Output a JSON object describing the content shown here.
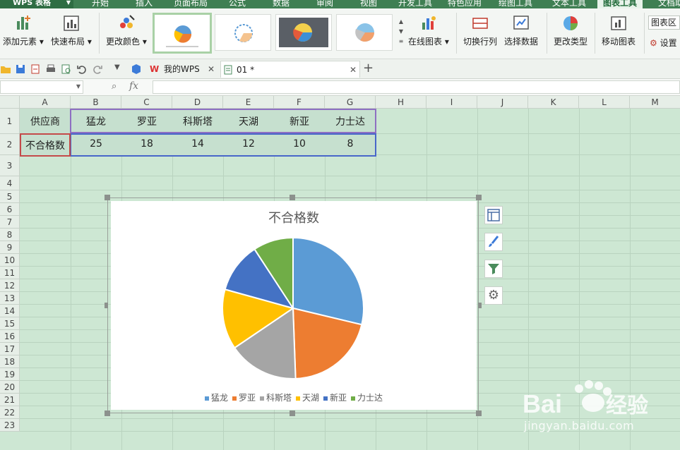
{
  "menubar": {
    "app_name": "WPS 表格",
    "items": [
      "开始",
      "插入",
      "页面布局",
      "公式",
      "数据",
      "审阅",
      "视图",
      "开发工具",
      "特色应用",
      "绘图工具",
      "文本工具",
      "图表工具",
      "文档助"
    ],
    "active": "图表工具"
  },
  "ribbon": {
    "add_element": "添加元素",
    "quick_layout": "快速布局",
    "change_color": "更改颜色",
    "online_chart": "在线图表",
    "switch_row_col": "切换行列",
    "select_data": "选择数据",
    "change_type": "更改类型",
    "move_chart": "移动图表",
    "chart_area": "图表区",
    "settings": "设置"
  },
  "tabs": {
    "my_wps": "我的WPS",
    "doc": "01 *",
    "add": "+"
  },
  "formula_bar": {
    "name_box": "",
    "fx": "fx",
    "formula": ""
  },
  "columns": [
    "A",
    "B",
    "C",
    "D",
    "E",
    "F",
    "G",
    "H",
    "I",
    "J",
    "K",
    "L",
    "M"
  ],
  "rows": [
    "1",
    "2",
    "3",
    "4",
    "5",
    "6",
    "7",
    "8",
    "9",
    "10",
    "11",
    "12",
    "13",
    "14",
    "15",
    "16",
    "17",
    "18",
    "19",
    "20",
    "21",
    "22",
    "23"
  ],
  "sheet": {
    "row1": [
      "供应商",
      "猛龙",
      "罗亚",
      "科斯塔",
      "天湖",
      "新亚",
      "力士达"
    ],
    "row2": [
      "不合格数",
      "25",
      "18",
      "14",
      "12",
      "10",
      "8"
    ]
  },
  "chart_data": {
    "type": "pie",
    "title": "不合格数",
    "categories": [
      "猛龙",
      "罗亚",
      "科斯塔",
      "天湖",
      "新亚",
      "力士达"
    ],
    "values": [
      25,
      18,
      14,
      12,
      10,
      8
    ],
    "colors": [
      "#5b9bd5",
      "#ed7d31",
      "#a5a5a5",
      "#ffc000",
      "#4472c4",
      "#70ad47"
    ],
    "legend": "bottom"
  },
  "watermark": {
    "brand": "Baidu经验",
    "url": "jingyan.baidu.com"
  }
}
